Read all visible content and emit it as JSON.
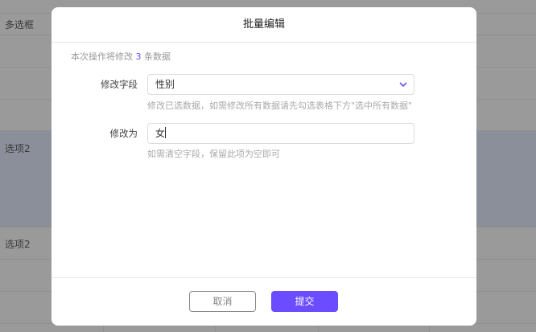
{
  "background_table": {
    "header": "多选框",
    "rows": [
      "选项2",
      "选项2"
    ]
  },
  "modal": {
    "title": "批量编辑",
    "info_prefix": "本次操作将修改",
    "info_count": "3",
    "info_suffix": "条数据",
    "field_label": "修改字段",
    "field_value": "性别",
    "field_hint": "修改已选数据，如需修改所有数据请先勾选表格下方\"选中所有数据\"",
    "value_label": "修改为",
    "value_input": "女",
    "value_hint": "如需清空字段，保留此项为空即可",
    "cancel_label": "取消",
    "submit_label": "提交",
    "accent_color": "#6c4cff"
  }
}
